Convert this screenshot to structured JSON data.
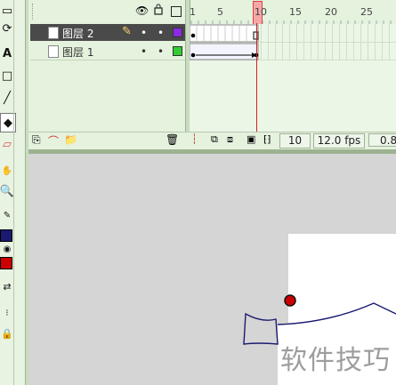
{
  "timeline": {
    "ruler_numbers": [
      "1",
      "5",
      "10",
      "15",
      "20",
      "25"
    ],
    "layers": [
      {
        "name": "图层 2",
        "selected": true,
        "color": "#8a2be2"
      },
      {
        "name": "图层 1",
        "selected": false,
        "color": "#33cc33"
      }
    ],
    "current_frame": "10",
    "fps": "12.0 fps",
    "elapsed": "0.8"
  },
  "watermark": "软件技巧",
  "colors": {
    "panel_bg": "#e5f2de",
    "selected_layer_bg": "#4a4a4a",
    "playhead": "#cc2222",
    "stroke_color": "#1a1a70",
    "fill_color": "#cc0000"
  },
  "icons": {
    "eye": "eye-icon",
    "lock": "lock-icon",
    "outline": "outline-icon",
    "pencil": "pencil-icon",
    "trash": "trash-icon"
  }
}
